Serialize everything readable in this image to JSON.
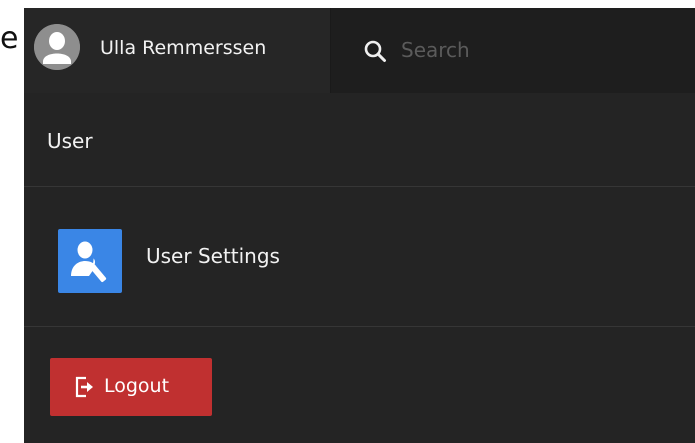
{
  "background_fragment": "e",
  "user": {
    "name": "Ulla Remmerssen",
    "avatar_icon": "user-silhouette-icon"
  },
  "search": {
    "placeholder": "Search",
    "value": "",
    "icon": "search-icon"
  },
  "section": {
    "title": "User"
  },
  "menu": {
    "items": [
      {
        "label": "User Settings",
        "icon": "user-settings-icon",
        "icon_color": "#3a86e6"
      }
    ]
  },
  "logout": {
    "label": "Logout",
    "icon": "logout-icon",
    "color": "#c03030"
  },
  "colors": {
    "panel": "#242424",
    "topbar": "#1e1e1e",
    "text": "#f2f2f2",
    "placeholder": "#5b5b5b"
  }
}
